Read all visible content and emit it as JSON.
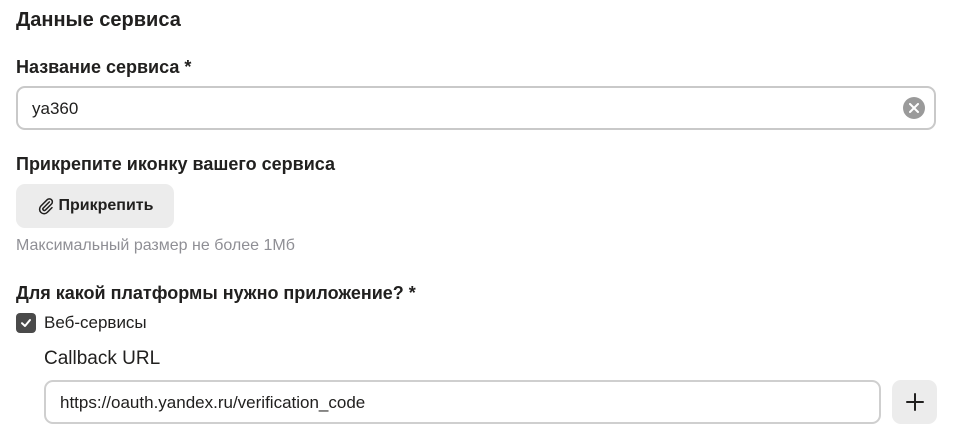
{
  "section": {
    "title": "Данные сервиса"
  },
  "service_name": {
    "label": "Название сервиса *",
    "value": "ya360",
    "clear_icon": "clear-icon"
  },
  "icon_upload": {
    "label": "Прикрепите иконку вашего сервиса",
    "button_label": "Прикрепить",
    "button_icon": "paperclip-icon",
    "hint": "Максимальный размер не более 1Мб"
  },
  "platform": {
    "label": "Для какой платформы нужно приложение? *",
    "options": [
      {
        "label": "Веб-сервисы",
        "checked": true
      }
    ]
  },
  "callback": {
    "label": "Callback URL",
    "value": "https://oauth.yandex.ru/verification_code",
    "add_icon": "plus-icon"
  },
  "colors": {
    "text": "#21201f",
    "hint": "#8f8f95",
    "button_bg": "#ececec",
    "input_border": "#c9c9c9",
    "checkbox_bg": "#4a4a4a"
  }
}
